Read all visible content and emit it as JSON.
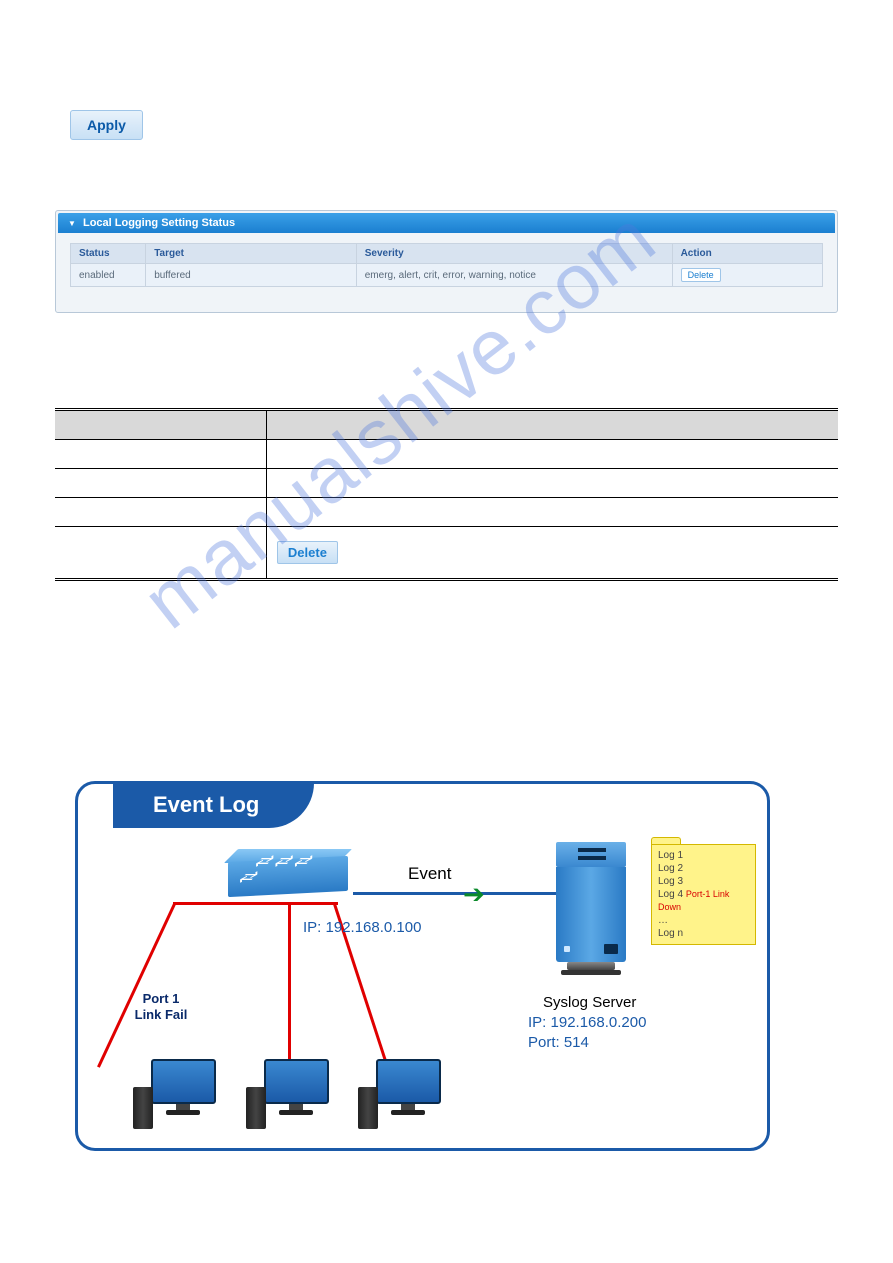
{
  "apply_label": "Apply",
  "panel": {
    "title": "Local Logging Setting Status",
    "headers": {
      "status": "Status",
      "target": "Target",
      "severity": "Severity",
      "action": "Action"
    },
    "row": {
      "status": "enabled",
      "target": "buffered",
      "severity": "emerg, alert, crit, error, warning, notice",
      "action": "Delete"
    }
  },
  "desc_table": {
    "delete_label": "Delete"
  },
  "diagram": {
    "tab": "Event Log",
    "event_label": "Event",
    "switch_ip": "IP: 192.168.0.100",
    "server_label": "Syslog Server",
    "server_ip": "IP: 192.168.0.200",
    "server_port": "Port: 514",
    "burst_line1": "Port 1",
    "burst_line2": "Link Fail",
    "logs": {
      "l1": "Log 1",
      "l2": "Log 2",
      "l3": "Log 3",
      "l4a": "Log 4",
      "l4b": "Port-1 Link Down",
      "dots": "…",
      "ln": "Log n"
    }
  },
  "watermark": "manualshive.com"
}
